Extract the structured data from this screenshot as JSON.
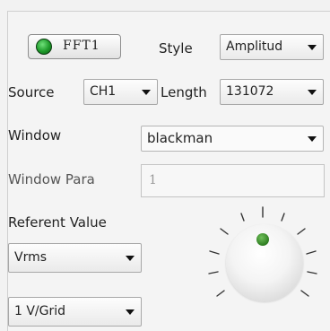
{
  "fft": {
    "label": "FFT1",
    "led_color": "#2e9b33"
  },
  "style": {
    "label": "Style",
    "value": "Amplitud"
  },
  "source": {
    "label": "Source",
    "value": "CH1"
  },
  "length": {
    "label": "Length",
    "value": "131072"
  },
  "window": {
    "label": "Window",
    "value": "blackman"
  },
  "window_para": {
    "label": "Window Para",
    "value": "1"
  },
  "referent": {
    "label": "Referent Value",
    "unit": "Vrms",
    "scale": "1 V/Grid"
  },
  "knob": {
    "indicator_color": "#2e7d21"
  }
}
